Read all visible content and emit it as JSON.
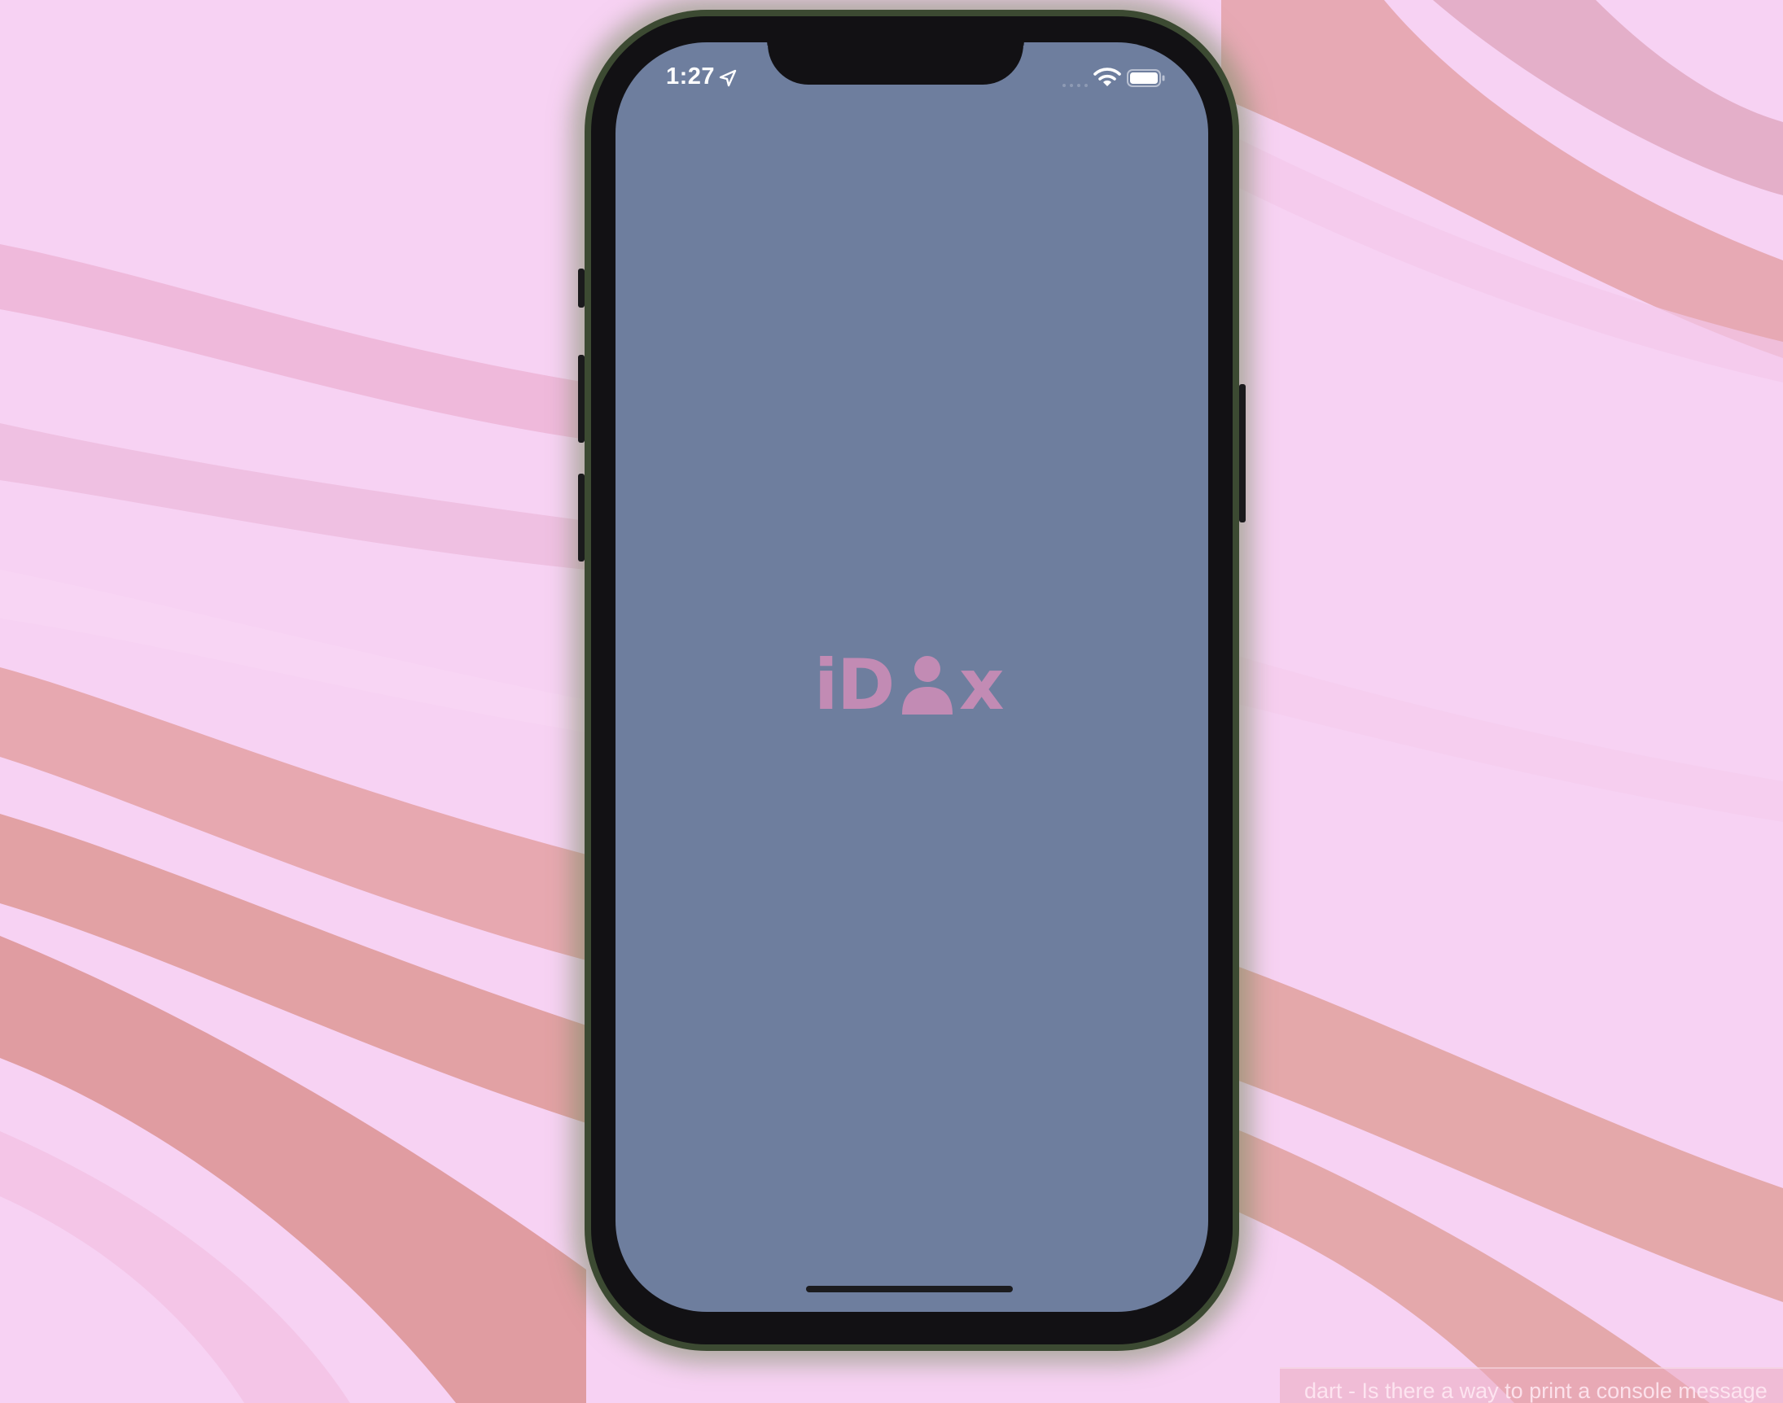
{
  "status_bar": {
    "time": "1:27"
  },
  "splash": {
    "logo_letter_i": "i",
    "logo_letter_d": "D",
    "logo_letter_x": "x",
    "logo_color": "#c28bb4",
    "background_color": "#6e7e9e"
  },
  "icons": {
    "location": "location-arrow-icon",
    "signal": "cellular-signal-icon",
    "wifi": "wifi-icon",
    "battery": "battery-icon",
    "logo_person": "person-icon"
  },
  "tooltip": {
    "text": "dart - Is there a way to print a console message"
  }
}
